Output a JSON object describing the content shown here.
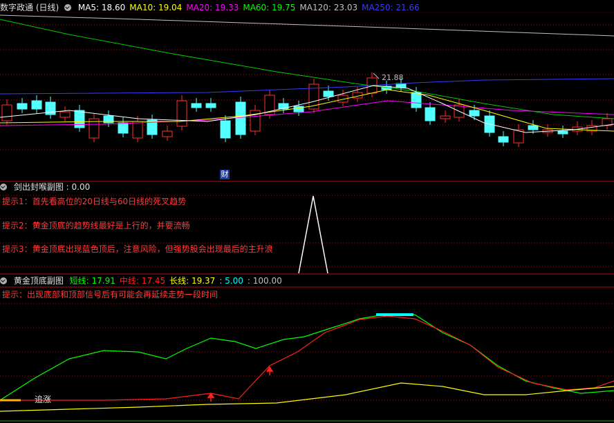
{
  "main_panel": {
    "title": "数字政通 (日线)",
    "indicators": [
      {
        "label": "MA5: 18.60",
        "color": "#ffffff"
      },
      {
        "label": "MA10: 19.04",
        "color": "#ffff00"
      },
      {
        "label": "MA20: 19.33",
        "color": "#ff00ff"
      },
      {
        "label": "MA60: 19.75",
        "color": "#00ff00"
      },
      {
        "label": "MA120: 23.03",
        "color": "#c0c0c0"
      },
      {
        "label": "MA250: 21.66",
        "color": "#3b3bff"
      }
    ],
    "high_marker": "21.88",
    "finance_badge": "财"
  },
  "sub_panel_1": {
    "title": "剑出封喉副图",
    "value": ": 0.00",
    "hints": [
      "提示1：首先看高位的20日线与60日线的死叉趋势",
      "提示2：黄金顶底的趋势线最好是上行的，并要流畅",
      "提示3：黄金顶底出现蓝色顶后，注意风险，但强势股会出现最后的主升浪"
    ]
  },
  "sub_panel_2": {
    "title": "黄金顶底副图",
    "values": [
      {
        "label": "短线: 17.91",
        "color": "#00ff00"
      },
      {
        "label": "中线: 17.45",
        "color": "#ff2020"
      },
      {
        "label": "长线: 19.37",
        "color": "#ffff00"
      },
      {
        "label": ": 5.00",
        "color": "#00ffff"
      },
      {
        "label": ": 100.00",
        "color": "#c0c0c0"
      }
    ],
    "hint": "提示：出现底部和顶部信号后有可能会再延续走势一段时间",
    "signal_label": "追涨"
  },
  "colors": {
    "background": "#000000",
    "up_candle": "#ff3030",
    "down_candle": "#54ffff",
    "panel_border": "#b01010",
    "grid": "#8b1a1a"
  }
}
